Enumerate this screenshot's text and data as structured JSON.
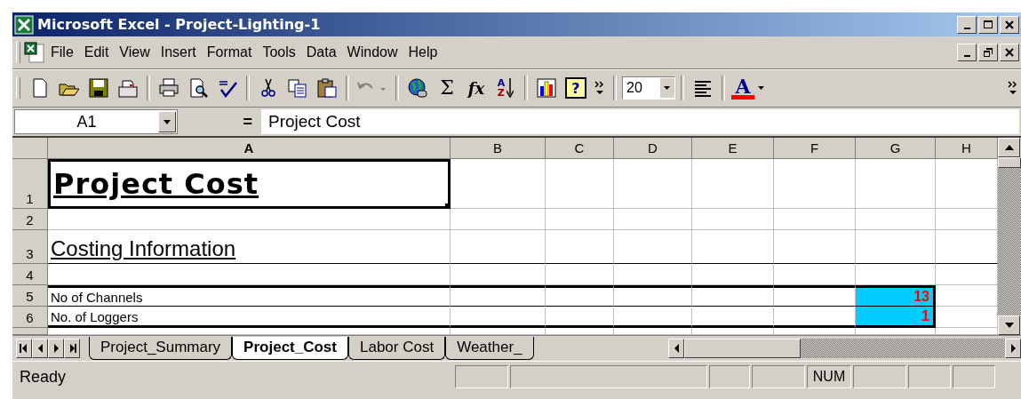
{
  "window": {
    "title": "Microsoft Excel - Project-Lighting-1"
  },
  "menu": {
    "items": [
      "File",
      "Edit",
      "View",
      "Insert",
      "Format",
      "Tools",
      "Data",
      "Window",
      "Help"
    ]
  },
  "toolbar": {
    "sum_glyph": "Σ",
    "function_glyph": "fx",
    "sort_glyphs": [
      "A",
      "Z"
    ],
    "help_glyph": "?",
    "font_size": "20",
    "font_color_glyph": "A"
  },
  "formula_bar": {
    "name_box": "A1",
    "equals": "=",
    "content": "Project Cost"
  },
  "sheet": {
    "columns": [
      "A",
      "B",
      "C",
      "D",
      "E",
      "F",
      "G",
      "H"
    ],
    "rows": [
      {
        "header": "1",
        "kind": "title",
        "label": "Project Cost",
        "selected": true
      },
      {
        "header": "2",
        "kind": "blank"
      },
      {
        "header": "3",
        "kind": "heading",
        "label": "Costing Information",
        "selected": false
      },
      {
        "header": "4",
        "kind": "blank"
      },
      {
        "header": "5",
        "kind": "data",
        "label": "No of Channels",
        "value": "13"
      },
      {
        "header": "6",
        "kind": "data",
        "label": "No. of Loggers",
        "value": "1"
      },
      {
        "kind": "partial"
      }
    ]
  },
  "sheet_tabs": [
    {
      "label": "Project_Summary",
      "selected": false
    },
    {
      "label": "Project_Cost",
      "selected": true
    },
    {
      "label": "Labor Cost",
      "selected": false
    },
    {
      "label": "Weather_",
      "selected": false
    }
  ],
  "status_bar": {
    "status": "Ready",
    "indicators": [
      "NUM"
    ]
  }
}
